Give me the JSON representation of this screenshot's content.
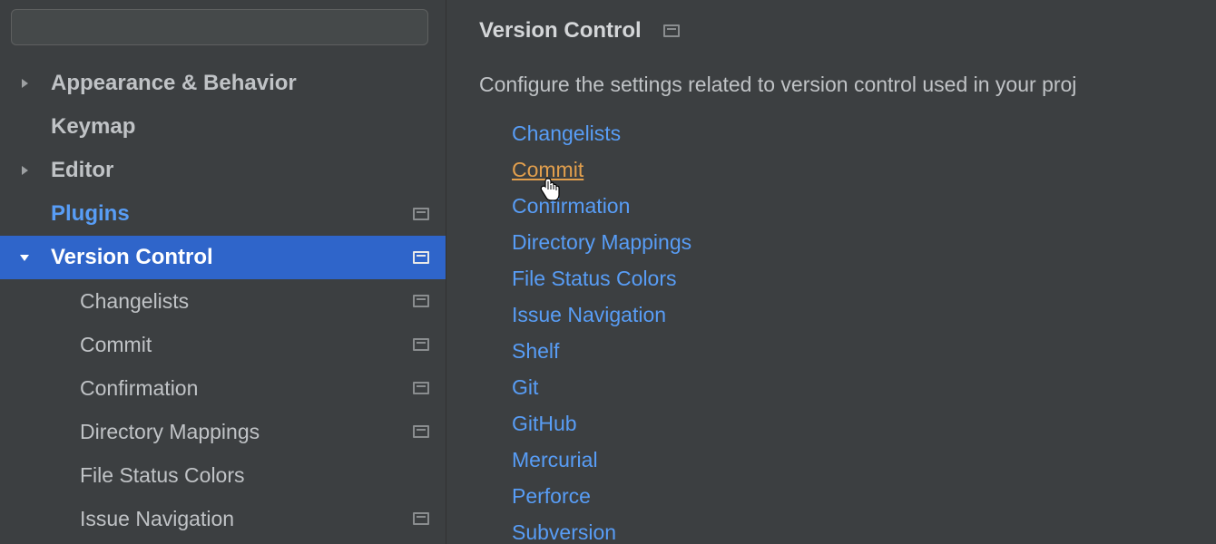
{
  "search": {
    "placeholder": "",
    "value": ""
  },
  "sidebar": {
    "items": [
      {
        "label": "Appearance & Behavior",
        "hasChevron": true,
        "expanded": false,
        "hasMarker": false,
        "selected": false,
        "highlighted": false,
        "child": false
      },
      {
        "label": "Keymap",
        "hasChevron": false,
        "expanded": false,
        "hasMarker": false,
        "selected": false,
        "highlighted": false,
        "child": false
      },
      {
        "label": "Editor",
        "hasChevron": true,
        "expanded": false,
        "hasMarker": false,
        "selected": false,
        "highlighted": false,
        "child": false
      },
      {
        "label": "Plugins",
        "hasChevron": false,
        "expanded": false,
        "hasMarker": true,
        "selected": false,
        "highlighted": true,
        "child": false
      },
      {
        "label": "Version Control",
        "hasChevron": true,
        "expanded": true,
        "hasMarker": true,
        "selected": true,
        "highlighted": false,
        "child": false
      },
      {
        "label": "Changelists",
        "hasChevron": false,
        "expanded": false,
        "hasMarker": true,
        "selected": false,
        "highlighted": false,
        "child": true
      },
      {
        "label": "Commit",
        "hasChevron": false,
        "expanded": false,
        "hasMarker": true,
        "selected": false,
        "highlighted": false,
        "child": true
      },
      {
        "label": "Confirmation",
        "hasChevron": false,
        "expanded": false,
        "hasMarker": true,
        "selected": false,
        "highlighted": false,
        "child": true
      },
      {
        "label": "Directory Mappings",
        "hasChevron": false,
        "expanded": false,
        "hasMarker": true,
        "selected": false,
        "highlighted": false,
        "child": true
      },
      {
        "label": "File Status Colors",
        "hasChevron": false,
        "expanded": false,
        "hasMarker": false,
        "selected": false,
        "highlighted": false,
        "child": true
      },
      {
        "label": "Issue Navigation",
        "hasChevron": false,
        "expanded": false,
        "hasMarker": true,
        "selected": false,
        "highlighted": false,
        "child": true
      }
    ]
  },
  "main": {
    "title": "Version Control",
    "description": "Configure the settings related to version control used in your proj",
    "links": [
      {
        "label": "Changelists",
        "hovered": false
      },
      {
        "label": "Commit",
        "hovered": true
      },
      {
        "label": "Confirmation",
        "hovered": false
      },
      {
        "label": "Directory Mappings",
        "hovered": false
      },
      {
        "label": "File Status Colors",
        "hovered": false
      },
      {
        "label": "Issue Navigation",
        "hovered": false
      },
      {
        "label": "Shelf",
        "hovered": false
      },
      {
        "label": "Git",
        "hovered": false
      },
      {
        "label": "GitHub",
        "hovered": false
      },
      {
        "label": "Mercurial",
        "hovered": false
      },
      {
        "label": "Perforce",
        "hovered": false
      },
      {
        "label": "Subversion",
        "hovered": false
      }
    ]
  }
}
